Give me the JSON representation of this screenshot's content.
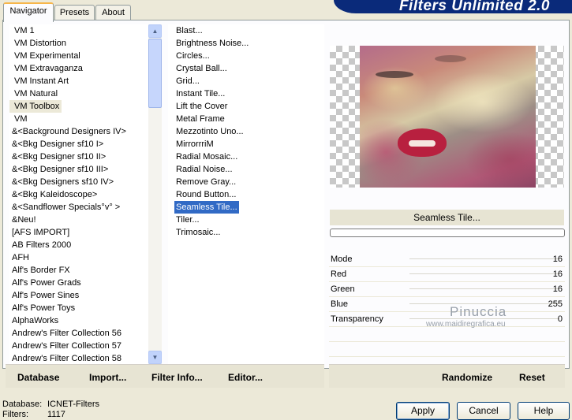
{
  "tabs": [
    {
      "label": "Navigator"
    },
    {
      "label": "Presets"
    },
    {
      "label": "About"
    }
  ],
  "banner": {
    "title": "Filters Unlimited 2.0"
  },
  "categories": [
    "VM 1",
    "VM Distortion",
    "VM Experimental",
    "VM Extravaganza",
    "VM Instant Art",
    "VM Natural",
    "VM Toolbox",
    "VM",
    "&<Background Designers IV>",
    "&<Bkg Designer sf10 I>",
    "&<Bkg Designer sf10 II>",
    "&<Bkg Designer sf10 III>",
    "&<Bkg Designers sf10 IV>",
    "&<Bkg Kaleidoscope>",
    "&<Sandflower Specials°v° >",
    "&Neu!",
    "[AFS IMPORT]",
    "AB Filters 2000",
    "AFH",
    "Alf's Border FX",
    "Alf's Power Grads",
    "Alf's Power Sines",
    "Alf's Power Toys",
    "AlphaWorks",
    "Andrew's Filter Collection 56",
    "Andrew's Filter Collection 57",
    "Andrew's Filter Collection 58"
  ],
  "selected_category": "VM Toolbox",
  "filters": [
    "Blast...",
    "Brightness Noise...",
    "Circles...",
    "Crystal Ball...",
    "Grid...",
    "Instant Tile...",
    "Lift the Cover",
    "Metal Frame",
    "Mezzotinto Uno...",
    "MirrorrriM",
    "Radial Mosaic...",
    "Radial Noise...",
    "Remove Gray...",
    "Round Button...",
    "Seamless Tile...",
    "Tiler...",
    "Trimosaic..."
  ],
  "selected_filter": "Seamless Tile...",
  "toolbar": {
    "database": "Database",
    "import": "Import...",
    "filter_info": "Filter Info...",
    "editor": "Editor...",
    "randomize": "Randomize",
    "reset": "Reset"
  },
  "preview": {
    "filter_name": "Seamless Tile...",
    "progress_fraction": 0
  },
  "params": [
    {
      "label": "Mode",
      "value": "16"
    },
    {
      "label": "Red",
      "value": "16"
    },
    {
      "label": "Green",
      "value": "16"
    },
    {
      "label": "Blue",
      "value": "255"
    },
    {
      "label": "Transparency",
      "value": "0"
    }
  ],
  "watermark": {
    "name": "Pinuccia",
    "url": "www.maidiregrafica.eu"
  },
  "status": {
    "database_label": "Database:",
    "database_value": "ICNET-Filters",
    "filters_label": "Filters:",
    "filters_value": "1117"
  },
  "buttons": {
    "apply": "Apply",
    "cancel": "Cancel",
    "help": "Help"
  }
}
